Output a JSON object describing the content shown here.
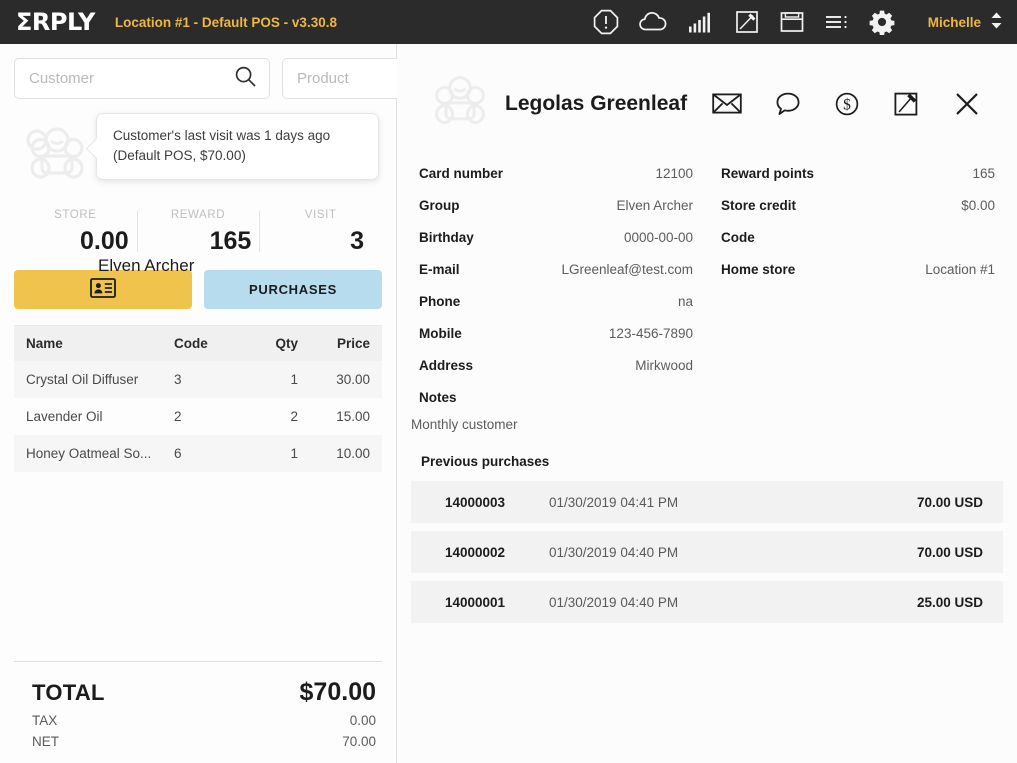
{
  "topbar": {
    "logo": "ΣRPLY",
    "location_title": "Location #1 - Default POS - v3.30.8",
    "user": "Michelle",
    "accent_color": "#eeb840",
    "background_color": "#2b2b2b",
    "icons": [
      "alert-octagon-icon",
      "cloud-icon",
      "signal-bars-icon",
      "edit-square-icon",
      "cash-drawer-icon",
      "menu-list-icon",
      "gear-icon"
    ]
  },
  "left_panel": {
    "search": {
      "customer_placeholder": "Customer",
      "customer_value": "",
      "product_placeholder": "Product",
      "product_value": ""
    },
    "customer": {
      "group_behind_tooltip": "Elven Archer",
      "tooltip_line1": "Customer's last visit was 1 days ago",
      "tooltip_line2": "(Default POS, $70.00)"
    },
    "stats": [
      {
        "label": "STORE",
        "value": "0.00"
      },
      {
        "label": "REWARD",
        "value": "165"
      },
      {
        "label": "VISIT",
        "value": "3"
      }
    ],
    "buttons": {
      "card_icon": "id-card-icon",
      "card_color": "#f0c44c",
      "purchases_label": "PURCHASES",
      "purchases_color": "#b6dced"
    },
    "table": {
      "headers": [
        "Name",
        "Code",
        "Qty",
        "Price"
      ],
      "rows": [
        {
          "name": "Crystal Oil Diffuser",
          "code": "3",
          "qty": "1",
          "price": "30.00"
        },
        {
          "name": "Lavender Oil",
          "code": "2",
          "qty": "2",
          "price": "15.00"
        },
        {
          "name": "Honey Oatmeal So...",
          "code": "6",
          "qty": "1",
          "price": "10.00"
        }
      ]
    },
    "totals": {
      "total_label": "TOTAL",
      "total_value": "$70.00",
      "tax_label": "TAX",
      "tax_value": "0.00",
      "net_label": "NET",
      "net_value": "70.00"
    }
  },
  "right_panel": {
    "customer_name": "Legolas Greenleaf",
    "actions": [
      "envelope-icon",
      "speech-bubble-icon",
      "dollar-circle-icon",
      "edit-square-icon",
      "close-icon"
    ],
    "fields_left": [
      {
        "key": "Card number",
        "value": "12100"
      },
      {
        "key": "Group",
        "value": "Elven Archer"
      },
      {
        "key": "Birthday",
        "value": "0000-00-00"
      },
      {
        "key": "E-mail",
        "value": "LGreenleaf@test.com"
      },
      {
        "key": "Phone",
        "value": "na"
      },
      {
        "key": "Mobile",
        "value": "123-456-7890"
      },
      {
        "key": "Address",
        "value": "Mirkwood"
      },
      {
        "key": "Notes",
        "value": ""
      }
    ],
    "fields_right": [
      {
        "key": "Reward points",
        "value": "165"
      },
      {
        "key": "Store credit",
        "value": "$0.00"
      },
      {
        "key": "Code",
        "value": ""
      },
      {
        "key": "Home store",
        "value": "Location #1"
      }
    ],
    "notes_text": "Monthly customer",
    "previous_purchases_title": "Previous purchases",
    "previous_purchases": [
      {
        "number": "14000003",
        "date": "01/30/2019 04:41 PM",
        "amount": "70.00 USD"
      },
      {
        "number": "14000002",
        "date": "01/30/2019 04:40 PM",
        "amount": "70.00 USD"
      },
      {
        "number": "14000001",
        "date": "01/30/2019 04:40 PM",
        "amount": "25.00 USD"
      }
    ]
  }
}
